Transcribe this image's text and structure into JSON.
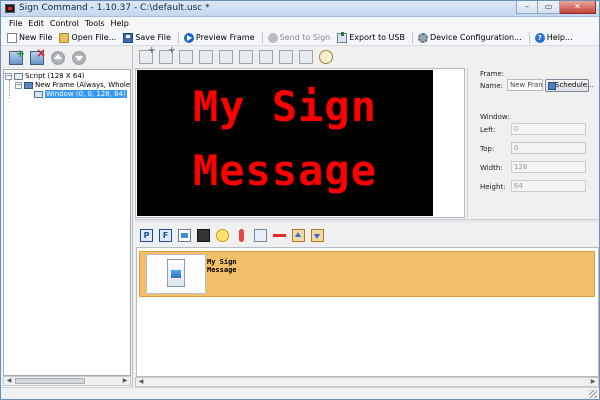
{
  "window": {
    "title": "Sign Command - 1.10.37 - C:\\default.usc *",
    "controls": {
      "minimize": "–",
      "maximize": "▭",
      "close": "✕"
    }
  },
  "menu": [
    "File",
    "Edit",
    "Control",
    "Tools",
    "Help"
  ],
  "toolbar": {
    "new_file": "New File",
    "open_file": "Open File...",
    "save_file": "Save File",
    "preview_frame": "Preview Frame",
    "send_to_sign": "Send to Sign",
    "export_usb": "Export to USB",
    "device_config": "Device Configuration...",
    "help": "Help..."
  },
  "tree": {
    "script": "Script (128 X 64)",
    "frame": "New Frame (Always, Wholeday)",
    "window": "Window (0, 0, 128, 64)"
  },
  "preview": {
    "line1": "My Sign",
    "line2": "Message",
    "text_color": "#ff0000",
    "background": "#000000"
  },
  "frame_panel": {
    "frame_heading": "Frame:",
    "name_label": "Name:",
    "name_value": "New Frame",
    "schedule_label": "Schedule...",
    "window_heading": "Window:",
    "left_label": "Left:",
    "left_value": "0",
    "top_label": "Top:",
    "top_value": "0",
    "width_label": "Width:",
    "width_value": "128",
    "height_label": "Height:",
    "height_value": "64"
  },
  "content_toolbar": {
    "p_label": "P",
    "f_label": "F"
  },
  "content_items": [
    {
      "text": "My Sign\nMessage"
    }
  ],
  "colors": {
    "selection": "#3399ff",
    "content_item_bg": "#f2c06a",
    "led_text": "#ff0000"
  }
}
